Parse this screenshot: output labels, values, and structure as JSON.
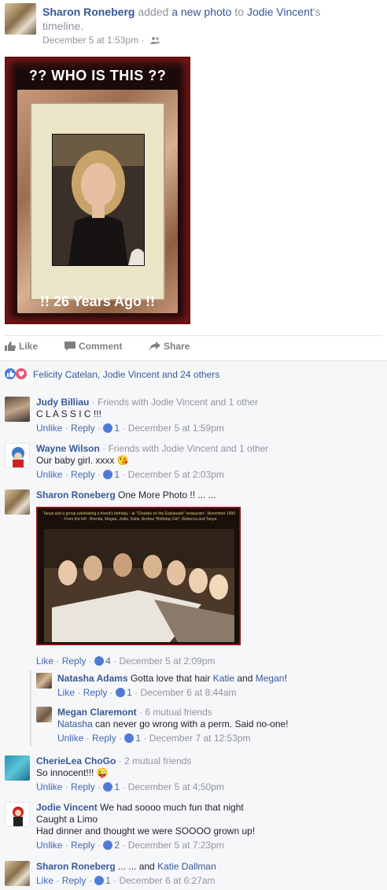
{
  "post": {
    "author": "Sharon Roneberg",
    "verb": "added",
    "object_link": "a new photo",
    "to_word": "to",
    "target": "Jodie Vincent",
    "suffix": "'s",
    "suffix2": "timeline.",
    "timestamp": "December 5 at 1:53pm",
    "photo_top_text": "?? WHO IS THIS ??",
    "photo_bottom_text": "!! 26 Years Ago !!"
  },
  "actions": {
    "like": "Like",
    "comment": "Comment",
    "share": "Share"
  },
  "reactions": {
    "text": "Felicity Catelan, Jodie Vincent and 24 others"
  },
  "comments": [
    {
      "name": "Judy Billiau",
      "sub": "· Friends with Jodie Vincent and 1 other",
      "text": "C L A S S I C !!!",
      "actions": [
        "Unlike",
        "Reply"
      ],
      "likes": "1",
      "time": "December 5 at 1:59pm"
    },
    {
      "name": "Wayne Wilson",
      "sub": "· Friends with Jodie Vincent and 1 other",
      "text": "Our baby girl. xxxx 😘",
      "actions": [
        "Unlike",
        "Reply"
      ],
      "likes": "1",
      "time": "December 5 at 2:03pm"
    },
    {
      "name": "Sharon Roneberg",
      "text": "One More Photo !! ... ...",
      "photo_caption": "Tanya and a group celebrating a friend's birthday - at \"Charlies on the Esplanade\" restaurant - November 1990 · From the left - Brenda, Megan, Jodie, Katie, Andrea \"Birthday Girl\", Rebecca and Tanya",
      "actions": [
        "Like",
        "Reply"
      ],
      "likes": "4",
      "time": "December 5 at 2:09pm"
    },
    {
      "name": "Natasha Adams",
      "text_pre": "Gotta love that hair",
      "mention1": "Katie",
      "and": "and",
      "mention2": "Megan",
      "text_post": "!",
      "actions": [
        "Like",
        "Reply"
      ],
      "likes": "1",
      "time": "December 6 at 8:44am"
    },
    {
      "name": "Megan Claremont",
      "sub": "· 6 mutual friends",
      "mention": "Natasha",
      "text": "can never go wrong with a perm. Said no-one!",
      "actions": [
        "Unlike",
        "Reply"
      ],
      "likes": "1",
      "time": "December 7 at 12:53pm"
    },
    {
      "name": "CherieLea ChoGo",
      "sub": "· 2 mutual friends",
      "text": "So innocent!!! 😜",
      "actions": [
        "Unlike",
        "Reply"
      ],
      "likes": "1",
      "time": "December 5 at 4:50pm"
    },
    {
      "name": "Jodie Vincent",
      "text": "We had soooo much fun that night",
      "text2": "Caught a Limo",
      "text3": "Had dinner and thought we were SOOOO grown up!",
      "actions": [
        "Unlike",
        "Reply"
      ],
      "likes": "2",
      "time": "December 5 at 7:23pm"
    },
    {
      "name": "Sharon Roneberg",
      "text": "... ... and",
      "mention": "Katie Dallman",
      "actions": [
        "Like",
        "Reply"
      ],
      "likes": "1",
      "time": "December 6 at 6:27am"
    }
  ],
  "colors": {
    "link": "#365899",
    "meta": "#90949c",
    "like_blue": "#4f7bd8",
    "love_red": "#f25268"
  }
}
